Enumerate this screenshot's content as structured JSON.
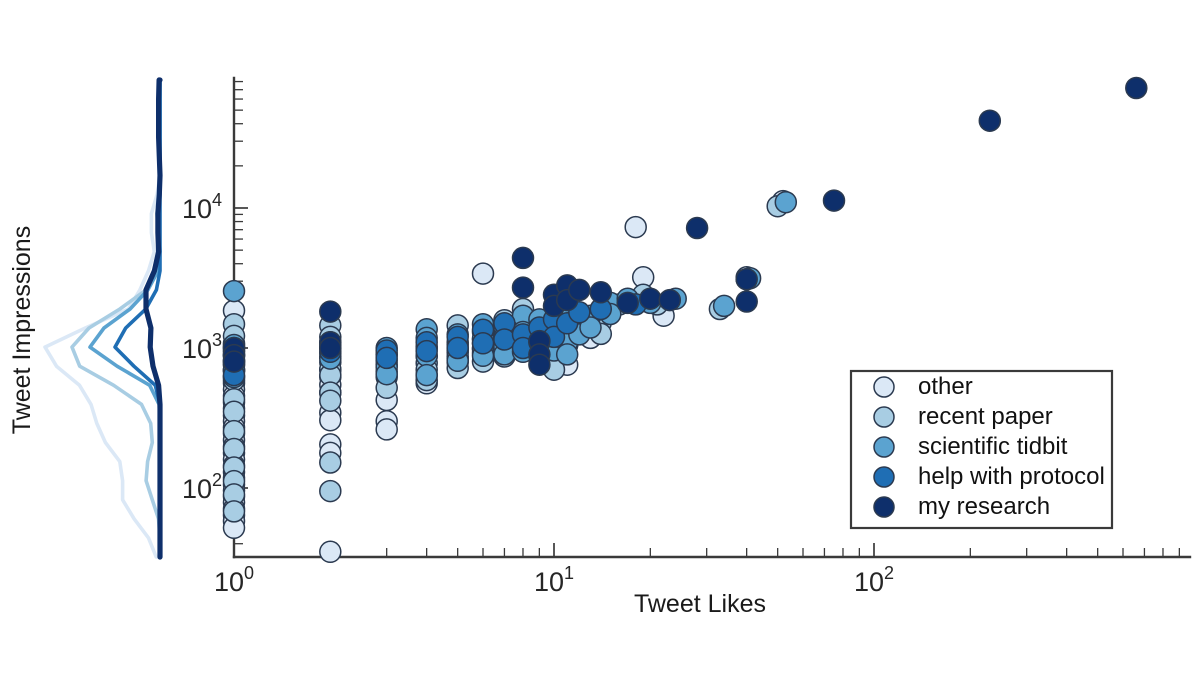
{
  "chart_data": {
    "type": "scatter",
    "title": "",
    "xlabel": "Tweet Likes",
    "ylabel": "Tweet Impressions",
    "xscale": "log",
    "yscale": "log",
    "xlim": [
      0.9,
      900
    ],
    "ylim": [
      28,
      90000
    ],
    "xticks": [
      "10^0",
      "10^1",
      "10^2"
    ],
    "xtick_values": [
      1,
      10,
      100
    ],
    "yticks": [
      "10^2",
      "10^3",
      "10^4"
    ],
    "ytick_values": [
      100,
      1000,
      10000
    ],
    "grid": false,
    "legend_position": "lower right",
    "marginal_plot": {
      "type": "kde-line",
      "axis": "y",
      "position": "left",
      "description": "five marginal density curves of Tweet Impressions, one per category, drawn in the matching series colors"
    },
    "series": [
      {
        "name": "other",
        "color": "#dbe8f6",
        "points": [
          [
            1,
            1850
          ],
          [
            1,
            1080
          ],
          [
            1,
            1020
          ],
          [
            1,
            900
          ],
          [
            1,
            760
          ],
          [
            1,
            700
          ],
          [
            1,
            620
          ],
          [
            1,
            560
          ],
          [
            1,
            505
          ],
          [
            1,
            455
          ],
          [
            1,
            410
          ],
          [
            1,
            370
          ],
          [
            1,
            330
          ],
          [
            1,
            300
          ],
          [
            1,
            270
          ],
          [
            1,
            245
          ],
          [
            1,
            220
          ],
          [
            1,
            198
          ],
          [
            1,
            178
          ],
          [
            1,
            160
          ],
          [
            1,
            145
          ],
          [
            1,
            130
          ],
          [
            1,
            118
          ],
          [
            1,
            106
          ],
          [
            1,
            96
          ],
          [
            1,
            87
          ],
          [
            1,
            79
          ],
          [
            1,
            71
          ],
          [
            1,
            64
          ],
          [
            1,
            58
          ],
          [
            1,
            52
          ],
          [
            2,
            1000
          ],
          [
            2,
            700
          ],
          [
            2,
            620
          ],
          [
            2,
            545
          ],
          [
            2,
            480
          ],
          [
            2,
            345
          ],
          [
            2,
            305
          ],
          [
            2,
            205
          ],
          [
            2,
            178
          ],
          [
            2,
            35
          ],
          [
            3,
            300
          ],
          [
            3,
            262
          ],
          [
            3,
            425
          ],
          [
            4,
            640
          ],
          [
            4,
            560
          ],
          [
            5,
            1000
          ],
          [
            5,
            870
          ],
          [
            5,
            790
          ],
          [
            6,
            980
          ],
          [
            6,
            1150
          ],
          [
            6,
            3400
          ],
          [
            7,
            1400
          ],
          [
            7,
            1050
          ],
          [
            7,
            880
          ],
          [
            8,
            1620
          ],
          [
            8,
            1330
          ],
          [
            9,
            1180
          ],
          [
            9,
            1000
          ],
          [
            10,
            930
          ],
          [
            10,
            1500
          ],
          [
            11,
            1060
          ],
          [
            11,
            760
          ],
          [
            13,
            1330
          ],
          [
            13,
            1180
          ],
          [
            18,
            7300
          ],
          [
            19,
            3200
          ],
          [
            22,
            1700
          ],
          [
            40,
            3200
          ],
          [
            52,
            11200
          ]
        ]
      },
      {
        "name": "recent paper",
        "color": "#a8cde3",
        "points": [
          [
            1,
            1480
          ],
          [
            1,
            1220
          ],
          [
            1,
            940
          ],
          [
            1,
            820
          ],
          [
            1,
            690
          ],
          [
            1,
            590
          ],
          [
            1,
            430
          ],
          [
            1,
            350
          ],
          [
            1,
            255
          ],
          [
            1,
            190
          ],
          [
            1,
            140
          ],
          [
            1,
            112
          ],
          [
            1,
            90
          ],
          [
            1,
            68
          ],
          [
            2,
            1450
          ],
          [
            2,
            1200
          ],
          [
            2,
            870
          ],
          [
            2,
            790
          ],
          [
            2,
            705
          ],
          [
            2,
            640
          ],
          [
            2,
            480
          ],
          [
            2,
            420
          ],
          [
            2,
            152
          ],
          [
            2,
            95
          ],
          [
            3,
            900
          ],
          [
            3,
            760
          ],
          [
            3,
            680
          ],
          [
            3,
            620
          ],
          [
            3,
            520
          ],
          [
            4,
            1020
          ],
          [
            4,
            870
          ],
          [
            4,
            780
          ],
          [
            4,
            700
          ],
          [
            4,
            590
          ],
          [
            5,
            1450
          ],
          [
            5,
            1100
          ],
          [
            5,
            960
          ],
          [
            5,
            840
          ],
          [
            5,
            720
          ],
          [
            6,
            1300
          ],
          [
            6,
            1080
          ],
          [
            6,
            920
          ],
          [
            6,
            800
          ],
          [
            7,
            1580
          ],
          [
            7,
            1240
          ],
          [
            7,
            1030
          ],
          [
            7,
            870
          ],
          [
            8,
            1900
          ],
          [
            8,
            1400
          ],
          [
            8,
            1120
          ],
          [
            9,
            1320
          ],
          [
            9,
            1000
          ],
          [
            9,
            830
          ],
          [
            10,
            1620
          ],
          [
            10,
            1210
          ],
          [
            10,
            700
          ],
          [
            11,
            1460
          ],
          [
            11,
            1050
          ],
          [
            12,
            1700
          ],
          [
            12,
            1320
          ],
          [
            14,
            1520
          ],
          [
            14,
            1260
          ],
          [
            16,
            2050
          ],
          [
            19,
            2400
          ],
          [
            21,
            2050
          ],
          [
            33,
            1900
          ],
          [
            40,
            3100
          ],
          [
            50,
            10300
          ]
        ]
      },
      {
        "name": "scientific tidbit",
        "color": "#5ba3d0",
        "points": [
          [
            1,
            2550
          ],
          [
            1,
            1050
          ],
          [
            1,
            960
          ],
          [
            1,
            880
          ],
          [
            1,
            810
          ],
          [
            1,
            760
          ],
          [
            1,
            680
          ],
          [
            1,
            620
          ],
          [
            2,
            1100
          ],
          [
            2,
            1000
          ],
          [
            2,
            920
          ],
          [
            2,
            840
          ],
          [
            3,
            1000
          ],
          [
            3,
            900
          ],
          [
            3,
            810
          ],
          [
            3,
            730
          ],
          [
            3,
            650
          ],
          [
            4,
            1360
          ],
          [
            4,
            1180
          ],
          [
            4,
            1000
          ],
          [
            4,
            880
          ],
          [
            4,
            640
          ],
          [
            5,
            1250
          ],
          [
            5,
            1060
          ],
          [
            5,
            930
          ],
          [
            5,
            810
          ],
          [
            6,
            1480
          ],
          [
            6,
            1170
          ],
          [
            6,
            1000
          ],
          [
            6,
            880
          ],
          [
            7,
            1400
          ],
          [
            7,
            1200
          ],
          [
            7,
            1020
          ],
          [
            7,
            900
          ],
          [
            8,
            1700
          ],
          [
            8,
            1300
          ],
          [
            8,
            1100
          ],
          [
            8,
            940
          ],
          [
            9,
            1600
          ],
          [
            9,
            1250
          ],
          [
            9,
            1030
          ],
          [
            9,
            880
          ],
          [
            10,
            1450
          ],
          [
            10,
            1150
          ],
          [
            10,
            960
          ],
          [
            11,
            1820
          ],
          [
            11,
            1380
          ],
          [
            11,
            1100
          ],
          [
            11,
            900
          ],
          [
            12,
            1600
          ],
          [
            12,
            1250
          ],
          [
            13,
            1700
          ],
          [
            13,
            1400
          ],
          [
            15,
            2100
          ],
          [
            15,
            1750
          ],
          [
            17,
            2250
          ],
          [
            20,
            2100
          ],
          [
            24,
            2250
          ],
          [
            34,
            2000
          ],
          [
            41,
            3150
          ],
          [
            53,
            11000
          ]
        ]
      },
      {
        "name": "help with protocol",
        "color": "#1f6eb4",
        "points": [
          [
            1,
            1000
          ],
          [
            1,
            880
          ],
          [
            1,
            790
          ],
          [
            1,
            700
          ],
          [
            1,
            640
          ],
          [
            2,
            1050
          ],
          [
            2,
            940
          ],
          [
            3,
            960
          ],
          [
            3,
            850
          ],
          [
            4,
            1100
          ],
          [
            4,
            950
          ],
          [
            5,
            1200
          ],
          [
            5,
            1000
          ],
          [
            6,
            1350
          ],
          [
            6,
            1080
          ],
          [
            7,
            1500
          ],
          [
            7,
            1150
          ],
          [
            8,
            1250
          ],
          [
            8,
            1000
          ],
          [
            9,
            1400
          ],
          [
            9,
            1100
          ],
          [
            10,
            1600
          ],
          [
            10,
            1200
          ],
          [
            11,
            1500
          ],
          [
            12,
            1800
          ],
          [
            14,
            1900
          ],
          [
            18,
            2050
          ]
        ]
      },
      {
        "name": "my research",
        "color": "#0e2f6b",
        "points": [
          [
            1,
            1000
          ],
          [
            1,
            890
          ],
          [
            1,
            800
          ],
          [
            2,
            1820
          ],
          [
            2,
            1100
          ],
          [
            2,
            1000
          ],
          [
            8,
            4400
          ],
          [
            8,
            2700
          ],
          [
            9,
            1120
          ],
          [
            9,
            900
          ],
          [
            9,
            760
          ],
          [
            10,
            2400
          ],
          [
            10,
            2000
          ],
          [
            11,
            2800
          ],
          [
            11,
            2200
          ],
          [
            12,
            2600
          ],
          [
            14,
            2500
          ],
          [
            17,
            2100
          ],
          [
            20,
            2250
          ],
          [
            23,
            2200
          ],
          [
            28,
            7200
          ],
          [
            40,
            3100
          ],
          [
            40,
            2150
          ],
          [
            75,
            11300
          ],
          [
            230,
            42000
          ],
          [
            660,
            72000
          ]
        ]
      }
    ]
  },
  "legend": {
    "entries": [
      {
        "label": "other",
        "color": "#dbe8f6"
      },
      {
        "label": "recent paper",
        "color": "#a8cde3"
      },
      {
        "label": "scientific tidbit",
        "color": "#5ba3d0"
      },
      {
        "label": "help with protocol",
        "color": "#1f6eb4"
      },
      {
        "label": "my research",
        "color": "#0e2f6b"
      }
    ]
  },
  "axes": {
    "x_title": "Tweet Likes",
    "y_title": "Tweet Impressions",
    "x_tick_labels": [
      {
        "base": "10",
        "exp": "0"
      },
      {
        "base": "10",
        "exp": "1"
      },
      {
        "base": "10",
        "exp": "2"
      }
    ],
    "y_tick_labels": [
      {
        "base": "10",
        "exp": "2"
      },
      {
        "base": "10",
        "exp": "3"
      },
      {
        "base": "10",
        "exp": "4"
      }
    ]
  }
}
